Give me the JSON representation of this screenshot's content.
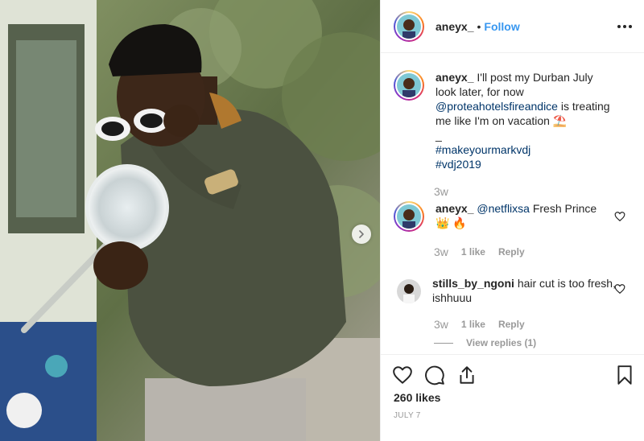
{
  "post": {
    "username": "aneyx_",
    "follow_separator": "•",
    "follow_label": "Follow",
    "likes_text": "260 likes",
    "date": "JULY 7"
  },
  "caption": {
    "username": "aneyx_",
    "text_1": "I'll post my Durban July look later, for now",
    "mention": "@proteahotelsfireandice",
    "text_2": "is treating me like I'm on vacation",
    "emoji": "⛱️",
    "separator": "_",
    "hashtag_1": "#makeyourmarkvdj",
    "hashtag_2": "#vdj2019",
    "time": "3w"
  },
  "comments": [
    {
      "username": "aneyx_",
      "mention": "@netflixsa",
      "text": "Fresh Prince",
      "emoji": "👑 🔥",
      "time": "3w",
      "likes": "1 like",
      "reply": "Reply"
    },
    {
      "username": "stills_by_ngoni",
      "text": "hair cut is too fresh, ishhuuu",
      "time": "3w",
      "likes": "1 like",
      "reply": "Reply",
      "view_replies": "View replies (1)"
    }
  ],
  "icons": {
    "more": "more-options-icon",
    "heart": "heart-icon",
    "comment": "comment-icon",
    "share": "share-icon",
    "save": "bookmark-icon",
    "next": "chevron-right-icon"
  },
  "colors": {
    "follow_blue": "#3897f0",
    "link_navy": "#003569",
    "text": "#262626",
    "muted": "#999999"
  }
}
